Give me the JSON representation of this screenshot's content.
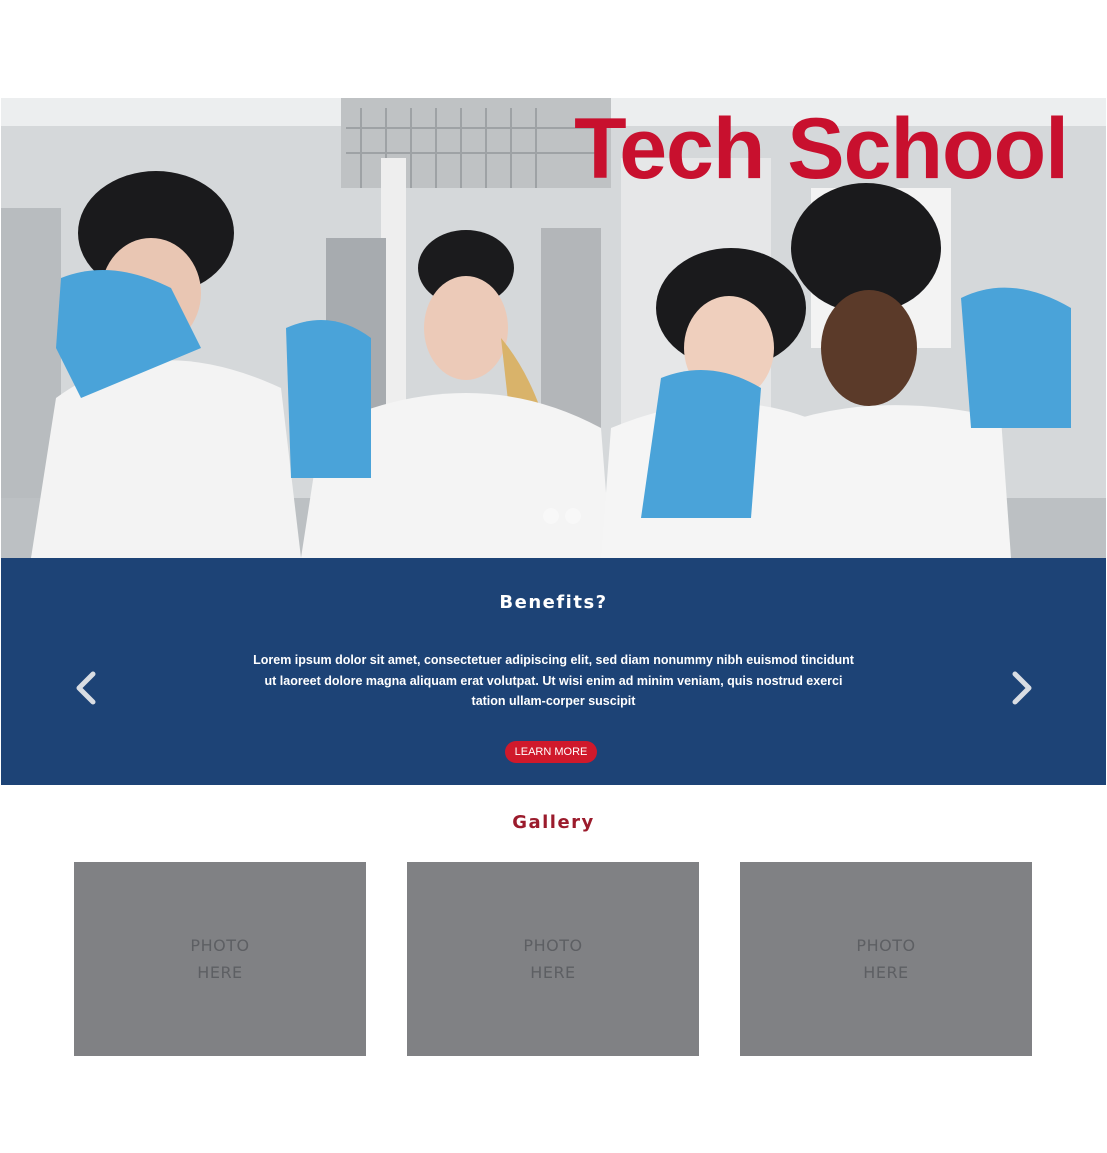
{
  "hero": {
    "title": "Tech School",
    "carousel": {
      "dot_count": 3,
      "active_index": 0
    }
  },
  "benefits": {
    "title": "Benefits?",
    "body": "Lorem ipsum dolor sit amet, consectetuer adipiscing elit, sed diam nonummy nibh euismod tincidunt ut laoreet dolore magna aliquam erat volutpat. Ut wisi enim ad minim veniam, quis nostrud exerci tation ullam-corper suscipit",
    "button_label": "LEARN MORE",
    "prev_icon": "chevron-left-icon",
    "next_icon": "chevron-right-icon"
  },
  "gallery": {
    "title": "Gallery",
    "items": [
      {
        "line1": "PHOTO",
        "line2": "HERE"
      },
      {
        "line1": "PHOTO",
        "line2": "HERE"
      },
      {
        "line1": "PHOTO",
        "line2": "HERE"
      }
    ]
  },
  "colors": {
    "brand_red": "#c8102e",
    "panel_blue": "#0d366e",
    "button_red": "#d0192b",
    "gallery_title": "#9b1b2c",
    "placeholder_gray": "#808184"
  }
}
